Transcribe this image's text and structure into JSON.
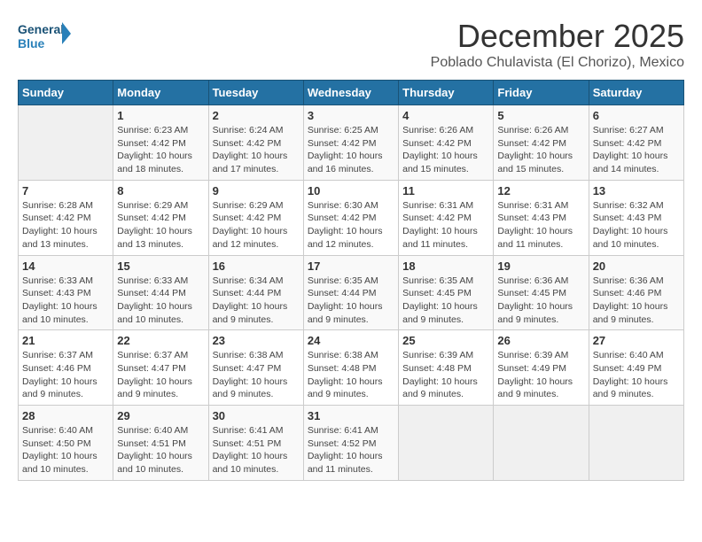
{
  "header": {
    "logo_general": "General",
    "logo_blue": "Blue",
    "month_title": "December 2025",
    "subtitle": "Poblado Chulavista (El Chorizo), Mexico"
  },
  "days_of_week": [
    "Sunday",
    "Monday",
    "Tuesday",
    "Wednesday",
    "Thursday",
    "Friday",
    "Saturday"
  ],
  "weeks": [
    [
      {
        "day": "",
        "info": ""
      },
      {
        "day": "1",
        "info": "Sunrise: 6:23 AM\nSunset: 4:42 PM\nDaylight: 10 hours\nand 18 minutes."
      },
      {
        "day": "2",
        "info": "Sunrise: 6:24 AM\nSunset: 4:42 PM\nDaylight: 10 hours\nand 17 minutes."
      },
      {
        "day": "3",
        "info": "Sunrise: 6:25 AM\nSunset: 4:42 PM\nDaylight: 10 hours\nand 16 minutes."
      },
      {
        "day": "4",
        "info": "Sunrise: 6:26 AM\nSunset: 4:42 PM\nDaylight: 10 hours\nand 15 minutes."
      },
      {
        "day": "5",
        "info": "Sunrise: 6:26 AM\nSunset: 4:42 PM\nDaylight: 10 hours\nand 15 minutes."
      },
      {
        "day": "6",
        "info": "Sunrise: 6:27 AM\nSunset: 4:42 PM\nDaylight: 10 hours\nand 14 minutes."
      }
    ],
    [
      {
        "day": "7",
        "info": "Sunrise: 6:28 AM\nSunset: 4:42 PM\nDaylight: 10 hours\nand 13 minutes."
      },
      {
        "day": "8",
        "info": "Sunrise: 6:29 AM\nSunset: 4:42 PM\nDaylight: 10 hours\nand 13 minutes."
      },
      {
        "day": "9",
        "info": "Sunrise: 6:29 AM\nSunset: 4:42 PM\nDaylight: 10 hours\nand 12 minutes."
      },
      {
        "day": "10",
        "info": "Sunrise: 6:30 AM\nSunset: 4:42 PM\nDaylight: 10 hours\nand 12 minutes."
      },
      {
        "day": "11",
        "info": "Sunrise: 6:31 AM\nSunset: 4:42 PM\nDaylight: 10 hours\nand 11 minutes."
      },
      {
        "day": "12",
        "info": "Sunrise: 6:31 AM\nSunset: 4:43 PM\nDaylight: 10 hours\nand 11 minutes."
      },
      {
        "day": "13",
        "info": "Sunrise: 6:32 AM\nSunset: 4:43 PM\nDaylight: 10 hours\nand 10 minutes."
      }
    ],
    [
      {
        "day": "14",
        "info": "Sunrise: 6:33 AM\nSunset: 4:43 PM\nDaylight: 10 hours\nand 10 minutes."
      },
      {
        "day": "15",
        "info": "Sunrise: 6:33 AM\nSunset: 4:44 PM\nDaylight: 10 hours\nand 10 minutes."
      },
      {
        "day": "16",
        "info": "Sunrise: 6:34 AM\nSunset: 4:44 PM\nDaylight: 10 hours\nand 9 minutes."
      },
      {
        "day": "17",
        "info": "Sunrise: 6:35 AM\nSunset: 4:44 PM\nDaylight: 10 hours\nand 9 minutes."
      },
      {
        "day": "18",
        "info": "Sunrise: 6:35 AM\nSunset: 4:45 PM\nDaylight: 10 hours\nand 9 minutes."
      },
      {
        "day": "19",
        "info": "Sunrise: 6:36 AM\nSunset: 4:45 PM\nDaylight: 10 hours\nand 9 minutes."
      },
      {
        "day": "20",
        "info": "Sunrise: 6:36 AM\nSunset: 4:46 PM\nDaylight: 10 hours\nand 9 minutes."
      }
    ],
    [
      {
        "day": "21",
        "info": "Sunrise: 6:37 AM\nSunset: 4:46 PM\nDaylight: 10 hours\nand 9 minutes."
      },
      {
        "day": "22",
        "info": "Sunrise: 6:37 AM\nSunset: 4:47 PM\nDaylight: 10 hours\nand 9 minutes."
      },
      {
        "day": "23",
        "info": "Sunrise: 6:38 AM\nSunset: 4:47 PM\nDaylight: 10 hours\nand 9 minutes."
      },
      {
        "day": "24",
        "info": "Sunrise: 6:38 AM\nSunset: 4:48 PM\nDaylight: 10 hours\nand 9 minutes."
      },
      {
        "day": "25",
        "info": "Sunrise: 6:39 AM\nSunset: 4:48 PM\nDaylight: 10 hours\nand 9 minutes."
      },
      {
        "day": "26",
        "info": "Sunrise: 6:39 AM\nSunset: 4:49 PM\nDaylight: 10 hours\nand 9 minutes."
      },
      {
        "day": "27",
        "info": "Sunrise: 6:40 AM\nSunset: 4:49 PM\nDaylight: 10 hours\nand 9 minutes."
      }
    ],
    [
      {
        "day": "28",
        "info": "Sunrise: 6:40 AM\nSunset: 4:50 PM\nDaylight: 10 hours\nand 10 minutes."
      },
      {
        "day": "29",
        "info": "Sunrise: 6:40 AM\nSunset: 4:51 PM\nDaylight: 10 hours\nand 10 minutes."
      },
      {
        "day": "30",
        "info": "Sunrise: 6:41 AM\nSunset: 4:51 PM\nDaylight: 10 hours\nand 10 minutes."
      },
      {
        "day": "31",
        "info": "Sunrise: 6:41 AM\nSunset: 4:52 PM\nDaylight: 10 hours\nand 11 minutes."
      },
      {
        "day": "",
        "info": ""
      },
      {
        "day": "",
        "info": ""
      },
      {
        "day": "",
        "info": ""
      }
    ]
  ]
}
